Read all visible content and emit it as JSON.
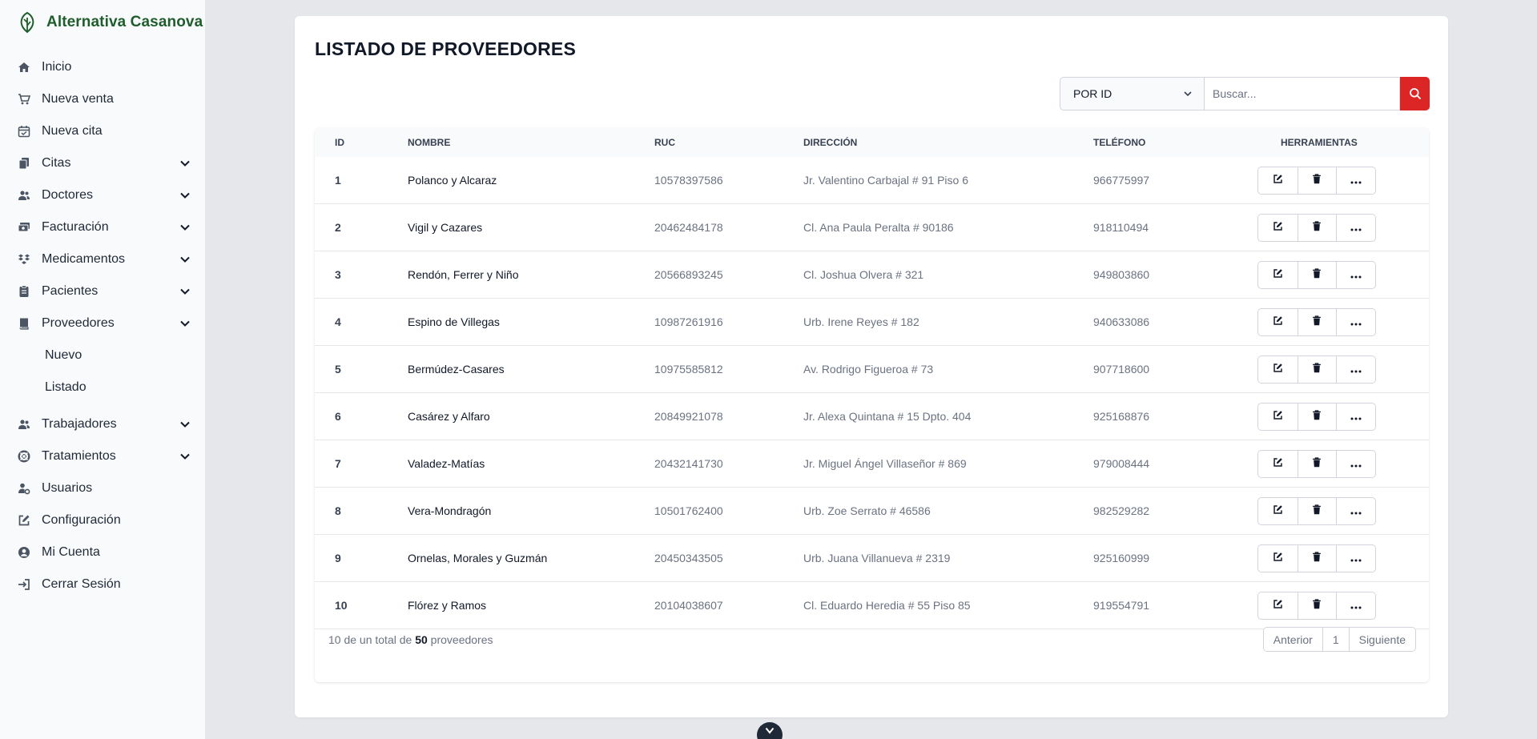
{
  "brand": {
    "name": "Alternativa Casanova"
  },
  "sidebar": {
    "items": [
      {
        "label": "Inicio",
        "icon": "home-icon"
      },
      {
        "label": "Nueva venta",
        "icon": "cart-icon"
      },
      {
        "label": "Nueva cita",
        "icon": "calendar-icon"
      },
      {
        "label": "Citas",
        "icon": "copy-icon",
        "expandable": true
      },
      {
        "label": "Doctores",
        "icon": "users-icon",
        "expandable": true
      },
      {
        "label": "Facturación",
        "icon": "money-icon",
        "expandable": true
      },
      {
        "label": "Medicamentos",
        "icon": "dropbox-icon",
        "expandable": true
      },
      {
        "label": "Pacientes",
        "icon": "clipboard-icon",
        "expandable": true
      },
      {
        "label": "Proveedores",
        "icon": "book-icon",
        "expandable": true,
        "expanded": true
      },
      {
        "label": "Trabajadores",
        "icon": "users-icon",
        "expandable": true
      },
      {
        "label": "Tratamientos",
        "icon": "lifebuoy-icon",
        "expandable": true
      },
      {
        "label": "Usuarios",
        "icon": "user-gear-icon"
      },
      {
        "label": "Configuración",
        "icon": "edit-square-icon"
      },
      {
        "label": "Mi Cuenta",
        "icon": "user-circle-icon"
      },
      {
        "label": "Cerrar Sesión",
        "icon": "sign-in-icon"
      }
    ],
    "subitems": [
      "Nuevo",
      "Listado"
    ]
  },
  "page": {
    "title": "LISTADO DE PROVEEDORES"
  },
  "search": {
    "filter_value": "POR ID",
    "placeholder": "Buscar..."
  },
  "table": {
    "headers": [
      "ID",
      "NOMBRE",
      "RUC",
      "DIRECCIÓN",
      "TELÉFONO",
      "HERRAMIENTAS"
    ],
    "rows": [
      [
        "1",
        "Polanco y Alcaraz",
        "10578397586",
        "Jr. Valentino Carbajal # 91 Piso 6",
        "966775997"
      ],
      [
        "2",
        "Vigil y Cazares",
        "20462484178",
        "Cl. Ana Paula Peralta # 90186",
        "918110494"
      ],
      [
        "3",
        "Rendón, Ferrer y Niño",
        "20566893245",
        "Cl. Joshua Olvera # 321",
        "949803860"
      ],
      [
        "4",
        "Espino de Villegas",
        "10987261916",
        "Urb. Irene Reyes # 182",
        "940633086"
      ],
      [
        "5",
        "Bermúdez-Casares",
        "10975585812",
        "Av. Rodrigo Figueroa # 73",
        "907718600"
      ],
      [
        "6",
        "Casárez y Alfaro",
        "20849921078",
        "Jr. Alexa Quintana # 15 Dpto. 404",
        "925168876"
      ],
      [
        "7",
        "Valadez-Matías",
        "20432141730",
        "Jr. Miguel Ángel Villaseñor # 869",
        "979008444"
      ],
      [
        "8",
        "Vera-Mondragón",
        "10501762400",
        "Urb. Zoe Serrato # 46586",
        "982529282"
      ],
      [
        "9",
        "Ornelas, Morales y Guzmán",
        "20450343505",
        "Urb. Juana Villanueva # 2319",
        "925160999"
      ],
      [
        "10",
        "Flórez y Ramos",
        "20104038607",
        "Cl. Eduardo Heredia # 55 Piso 85",
        "919554791"
      ]
    ]
  },
  "footer": {
    "summary_prefix": "10 de un total de",
    "total": "50",
    "summary_suffix": "proveedores",
    "prev": "Anterior",
    "page": "1",
    "next": "Siguiente"
  },
  "colors": {
    "brand": "#1f5e2c",
    "accent": "#dc2626",
    "sidebar_bg": "#f9fafb",
    "page_bg": "#e5e7eb"
  }
}
